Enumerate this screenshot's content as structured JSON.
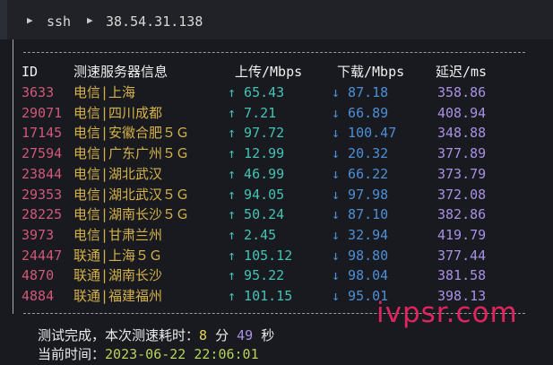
{
  "breadcrumb": {
    "items": [
      "ssh",
      "38.54.31.138"
    ]
  },
  "table": {
    "headers": [
      "ID",
      "测速服务器信息",
      "上传/Mbps",
      "下载/Mbps",
      "延迟/ms"
    ],
    "rows": [
      {
        "id": "3633",
        "name": "电信|上海",
        "up": "↑ 65.43",
        "down": "↓ 87.18",
        "lat": "358.86"
      },
      {
        "id": "29071",
        "name": "电信|四川成都",
        "up": "↑ 7.21",
        "down": "↓ 66.89",
        "lat": "408.94"
      },
      {
        "id": "17145",
        "name": "电信|安徽合肥５Ｇ",
        "up": "↑ 97.72",
        "down": "↓ 100.47",
        "lat": "348.88"
      },
      {
        "id": "27594",
        "name": "电信|广东广州５Ｇ",
        "up": "↑ 12.99",
        "down": "↓ 20.32",
        "lat": "377.89"
      },
      {
        "id": "23844",
        "name": "电信|湖北武汉",
        "up": "↑ 46.99",
        "down": "↓ 66.22",
        "lat": "373.79"
      },
      {
        "id": "29353",
        "name": "电信|湖北武汉５Ｇ",
        "up": "↑ 94.05",
        "down": "↓ 97.98",
        "lat": "372.08"
      },
      {
        "id": "28225",
        "name": "电信|湖南长沙５Ｇ",
        "up": "↑ 50.24",
        "down": "↓ 87.10",
        "lat": "382.86"
      },
      {
        "id": "3973",
        "name": "电信|甘肃兰州",
        "up": "↑ 2.45",
        "down": "↓ 32.94",
        "lat": "419.79"
      },
      {
        "id": "24447",
        "name": "联通|上海５Ｇ",
        "up": "↑ 105.12",
        "down": "↓ 98.80",
        "lat": "377.44"
      },
      {
        "id": "4870",
        "name": "联通|湖南长沙",
        "up": "↑ 95.22",
        "down": "↓ 98.04",
        "lat": "381.58"
      },
      {
        "id": "4884",
        "name": "联通|福建福州",
        "up": "↑ 101.15",
        "down": "↓ 95.01",
        "lat": "398.13"
      }
    ]
  },
  "summary": {
    "done_prefix": "测试完成，本次测速耗时：",
    "minutes": "8",
    "min_unit": "分",
    "seconds": "49",
    "sec_unit": "秒",
    "time_prefix": "当前时间：",
    "time_value": "2023-06-22 22:06:01"
  },
  "watermark": "ivpsr.com",
  "colors": {
    "id": "#d15878",
    "name": "#d6b24a",
    "upload": "#45c2b5",
    "download": "#4d8fd6",
    "latency": "#a891e4",
    "time": "#b7d35a"
  }
}
